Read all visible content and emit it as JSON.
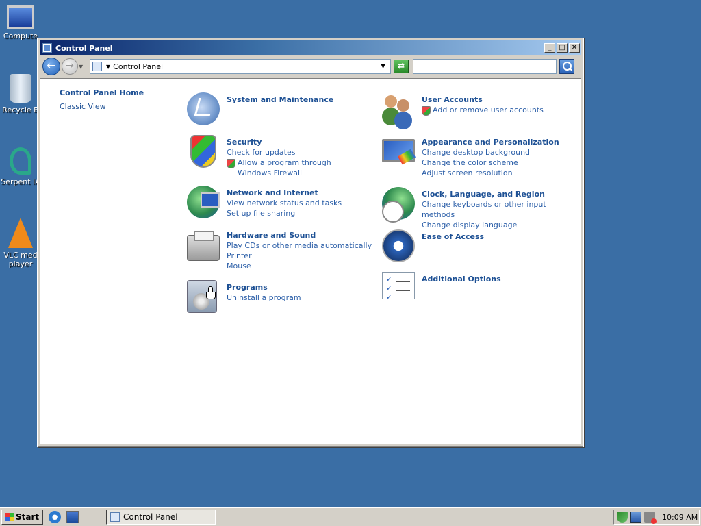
{
  "desktop": {
    "icons": [
      {
        "label": "Compute"
      },
      {
        "label": "Recycle B"
      },
      {
        "label": "Serpent IA"
      },
      {
        "label": "VLC med\nplayer"
      }
    ]
  },
  "window": {
    "title": "Control Panel",
    "controls": {
      "minimize": "_",
      "maximize": "□",
      "close": "✕"
    }
  },
  "navbar": {
    "back": "←",
    "forward": "→",
    "address": "Control Panel",
    "search_value": ""
  },
  "sidebar": {
    "home": "Control Panel Home",
    "classic": "Classic View"
  },
  "categories": {
    "system": {
      "title": "System and Maintenance",
      "icon": "system-maintenance-icon"
    },
    "security": {
      "title": "Security",
      "links": [
        "Check for updates",
        "Allow a program through Windows Firewall"
      ],
      "icon": "security-shield-icon"
    },
    "network": {
      "title": "Network and Internet",
      "links": [
        "View network status and tasks",
        "Set up file sharing"
      ],
      "icon": "network-globe-icon"
    },
    "hardware": {
      "title": "Hardware and Sound",
      "links": [
        "Play CDs or other media automatically",
        "Printer",
        "Mouse"
      ],
      "icon": "printer-icon"
    },
    "programs": {
      "title": "Programs",
      "links": [
        "Uninstall a program"
      ],
      "icon": "programs-disc-icon"
    },
    "users": {
      "title": "User Accounts",
      "links": [
        "Add or remove user accounts"
      ],
      "icon": "users-icon"
    },
    "appearance": {
      "title": "Appearance and Personalization",
      "links": [
        "Change desktop background",
        "Change the color scheme",
        "Adjust screen resolution"
      ],
      "icon": "monitor-paint-icon"
    },
    "clock": {
      "title": "Clock, Language, and Region",
      "links": [
        "Change keyboards or other input methods",
        "Change display language"
      ],
      "icon": "clock-globe-icon"
    },
    "ease": {
      "title": "Ease of Access",
      "icon": "ease-of-access-icon"
    },
    "additional": {
      "title": "Additional Options",
      "icon": "checklist-icon"
    }
  },
  "taskbar": {
    "start": "Start",
    "task": "Control Panel",
    "clock": "10:09 AM"
  },
  "colors": {
    "desktop": "#3a6ea5",
    "link": "#1d5094",
    "titlebar": "#0a246a"
  }
}
